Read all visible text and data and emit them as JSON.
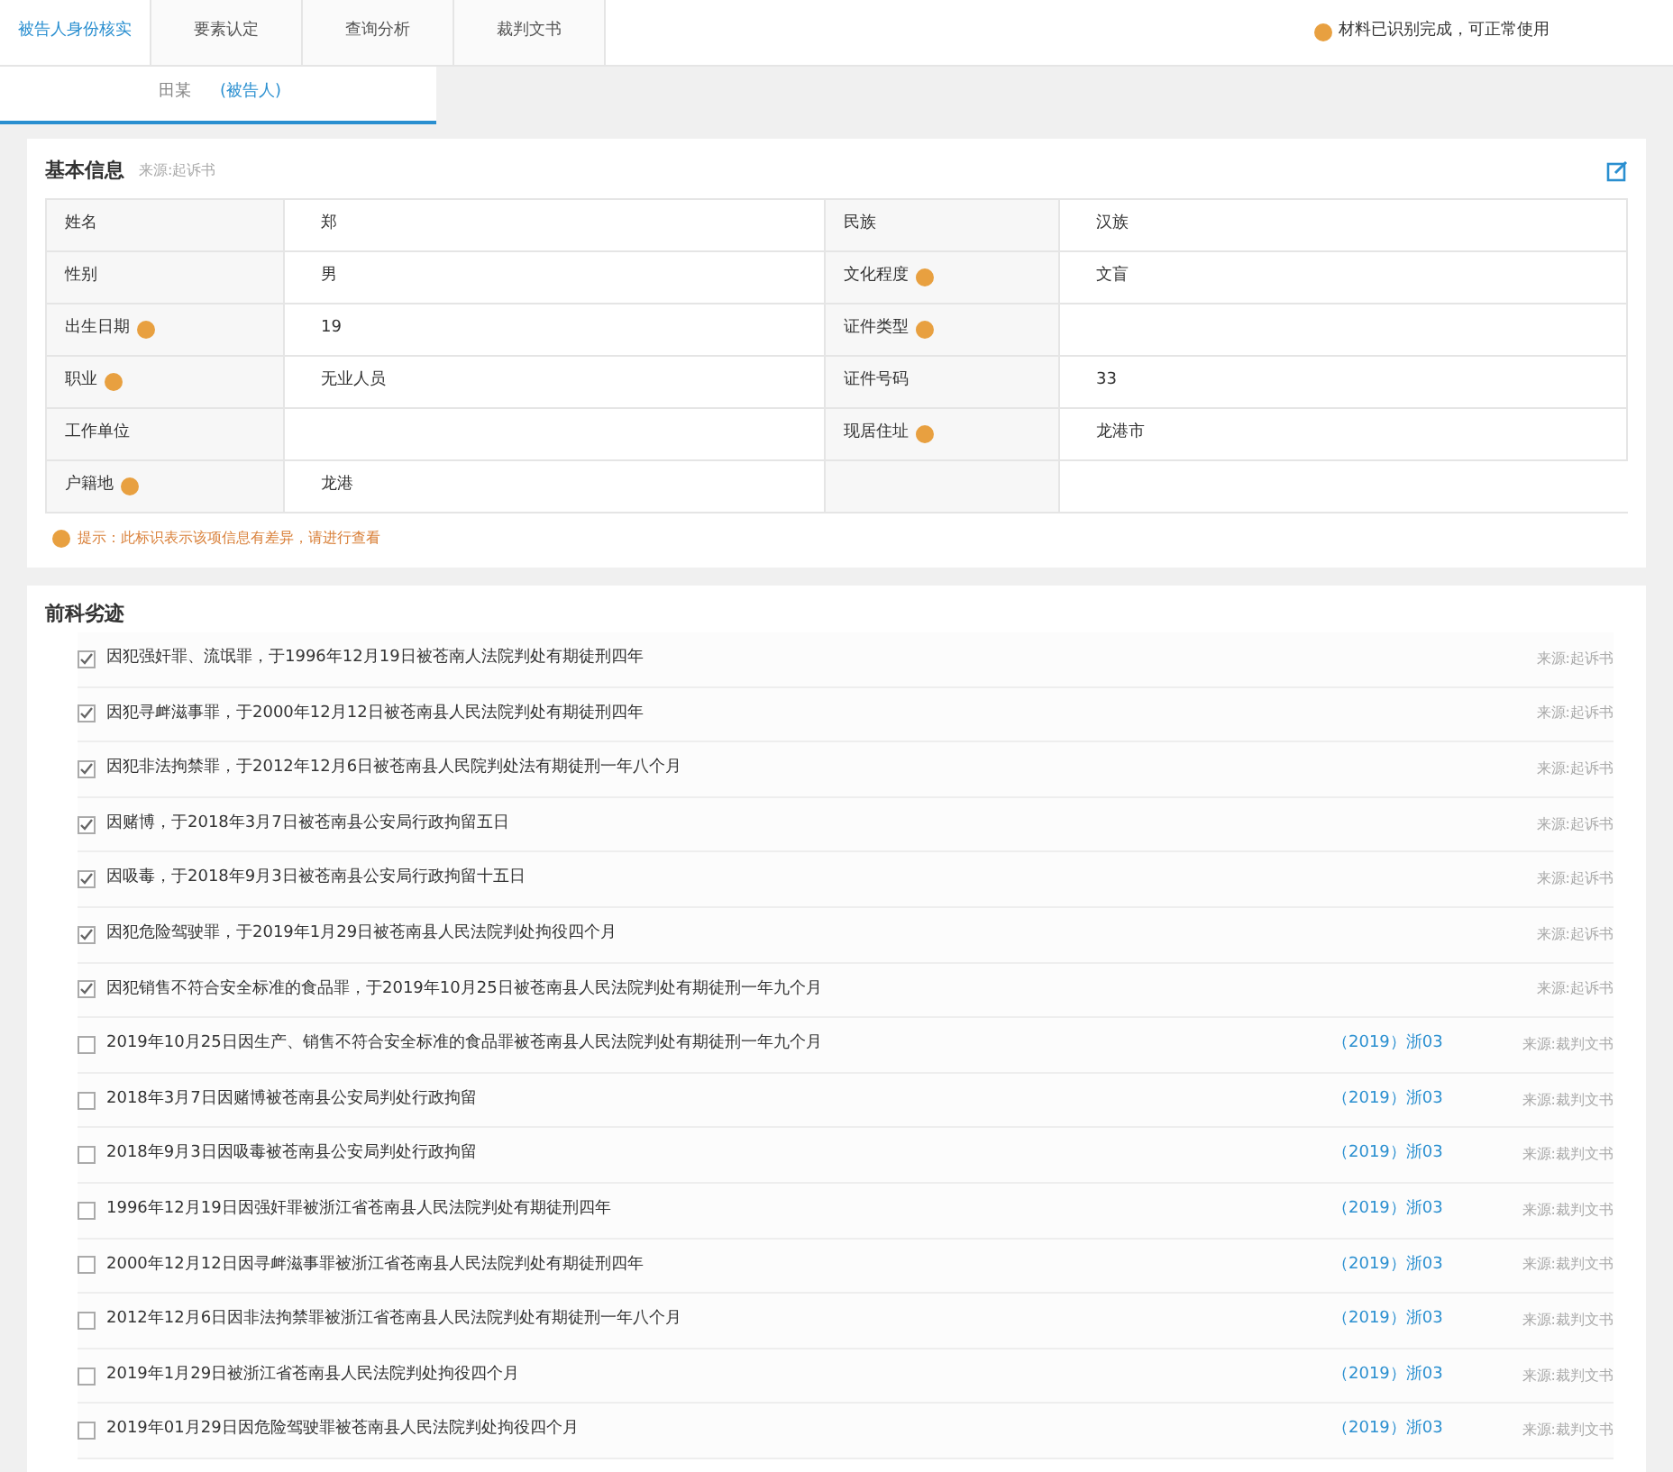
{
  "tabs": [
    {
      "label": "被告人身份核实",
      "selected": true
    },
    {
      "label": "要素认定",
      "selected": false
    },
    {
      "label": "查询分析",
      "selected": false
    },
    {
      "label": "裁判文书",
      "selected": false
    }
  ],
  "notice": "材料已识别完成，可正常使用",
  "subtabs": [
    {
      "label": "田某",
      "selected": false
    },
    {
      "label": "(被告人)",
      "selected": true
    }
  ],
  "basic": {
    "title": "基本信息",
    "source": "来源:起诉书",
    "fields": [
      {
        "label": "姓名",
        "warn": false,
        "value": "郑"
      },
      {
        "label": "民族",
        "warn": false,
        "value": "汉族"
      },
      {
        "label": "性别",
        "warn": false,
        "value": "男"
      },
      {
        "label": "文化程度",
        "warn": true,
        "value": "文盲"
      },
      {
        "label": "出生日期",
        "warn": true,
        "value": "19"
      },
      {
        "label": "证件类型",
        "warn": true
      },
      {
        "label": "职业",
        "warn": true,
        "value": "无业人员"
      },
      {
        "label": "证件号码",
        "warn": false,
        "value": "33"
      },
      {
        "label": "工作单位",
        "warn": false
      },
      {
        "label": "现居住址",
        "warn": true,
        "value": "龙港市"
      },
      {
        "label": "户籍地",
        "warn": true,
        "value": "龙港"
      }
    ],
    "hint": "提示：此标识表示该项信息有差异，请进行查看"
  },
  "records": {
    "title": "前科劣迹",
    "items": [
      {
        "text": "因犯强奸罪、流氓罪，于1996年12月19日被苍南人法院判处有期徒刑四年",
        "checked": true,
        "source": "来源:起诉书"
      },
      {
        "text": "因犯寻衅滋事罪，于2000年12月12日被苍南县人民法院判处有期徒刑四年",
        "checked": true,
        "source": "来源:起诉书"
      },
      {
        "text": "因犯非法拘禁罪，于2012年12月6日被苍南县人民院判处法有期徒刑一年八个月",
        "checked": true,
        "source": "来源:起诉书"
      },
      {
        "text": "因赌博，于2018年3月7日被苍南县公安局行政拘留五日",
        "checked": true,
        "source": "来源:起诉书"
      },
      {
        "text": "因吸毒，于2018年9月3日被苍南县公安局行政拘留十五日",
        "checked": true,
        "source": "来源:起诉书"
      },
      {
        "text": "因犯危险驾驶罪，于2019年1月29日被苍南县人民法院判处拘役四个月",
        "checked": true,
        "source": "来源:起诉书"
      },
      {
        "text": "因犯销售不符合安全标准的食品罪，于2019年10月25日被苍南县人民法院判处有期徒刑一年九个月",
        "checked": true,
        "source": "来源:起诉书"
      },
      {
        "text": "2019年10月25日因生产、销售不符合安全标准的食品罪被苍南县人民法院判处有期徒刑一年九个月",
        "checked": false,
        "case": "（2019）浙03",
        "source": "来源:裁判文书"
      },
      {
        "text": "2018年3月7日因赌博被苍南县公安局判处行政拘留",
        "checked": false,
        "case": "（2019）浙03",
        "source": "来源:裁判文书"
      },
      {
        "text": "2018年9月3日因吸毒被苍南县公安局判处行政拘留",
        "checked": false,
        "case": "（2019）浙03",
        "source": "来源:裁判文书"
      },
      {
        "text": "1996年12月19日因强奸罪被浙江省苍南县人民法院判处有期徒刑四年",
        "checked": false,
        "case": "（2019）浙03",
        "source": "来源:裁判文书"
      },
      {
        "text": "2000年12月12日因寻衅滋事罪被浙江省苍南县人民法院判处有期徒刑四年",
        "checked": false,
        "case": "（2019）浙03",
        "source": "来源:裁判文书"
      },
      {
        "text": "2012年12月6日因非法拘禁罪被浙江省苍南县人民法院判处有期徒刑一年八个月",
        "checked": false,
        "case": "（2019）浙03",
        "source": "来源:裁判文书"
      },
      {
        "text": "2019年1月29日被浙江省苍南县人民法院判处拘役四个月",
        "checked": false,
        "case": "（2019）浙03",
        "source": "来源:裁判文书"
      },
      {
        "text": "2019年01月29日因危险驾驶罪被苍南县人民法院判处拘役四个月",
        "checked": false,
        "case": "（2019）浙03",
        "source": "来源:裁判文书"
      }
    ]
  }
}
